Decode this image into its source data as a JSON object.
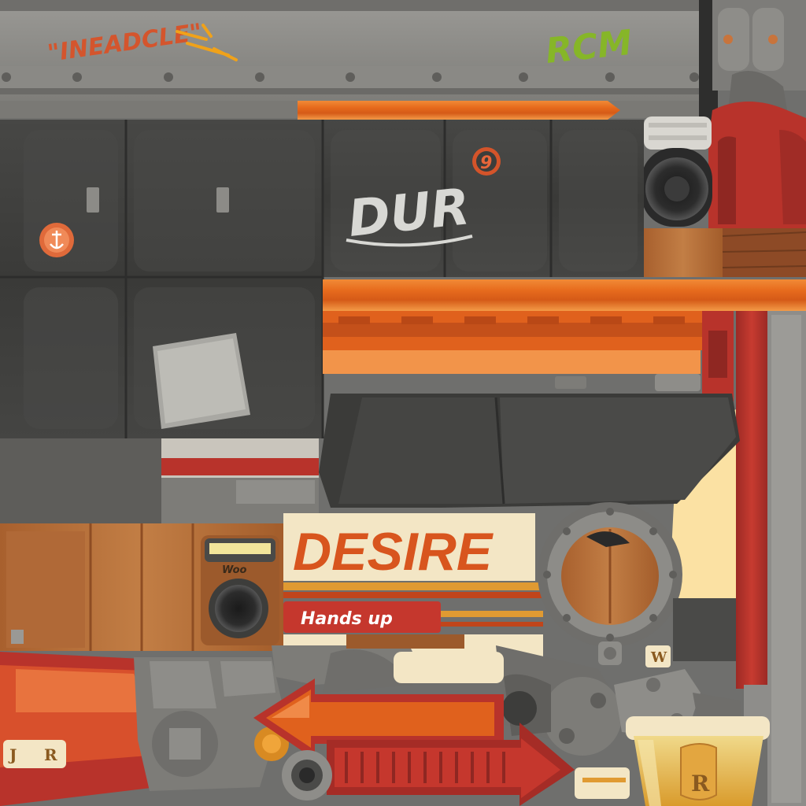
{
  "texture": {
    "graffiti_top_left": "\"INEADCLE\"",
    "graffiti_top_right": "RCM",
    "graffiti_center": "DUR",
    "sticker_nine": "9",
    "speaker_brand": "Woo",
    "sign_title": "DESIRE",
    "sign_subtitle": "Hands up",
    "badge_w": "W",
    "plate_j": "J",
    "plate_r": "R",
    "cup_letter": "R"
  },
  "colors": {
    "orange": "#e0611d",
    "red": "#b8332b",
    "dark_panel": "#3e3e3c",
    "grey_metal": "#8f8e8a",
    "wood": "#b7723d",
    "lime": "#86b628",
    "cream": "#f3e6c5"
  }
}
